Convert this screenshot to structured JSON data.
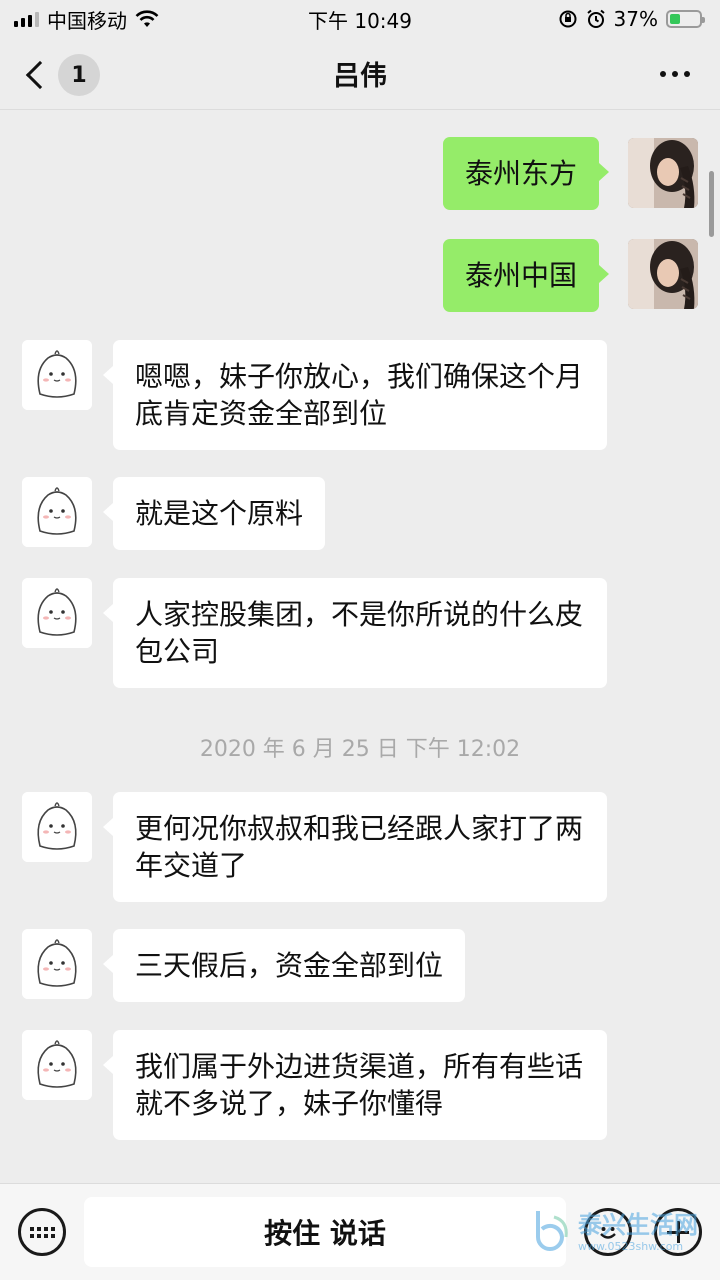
{
  "status_bar": {
    "carrier": "中国移动",
    "time": "下午 10:49",
    "battery_percent": "37%",
    "battery_level": 0.37
  },
  "header": {
    "back_count": "1",
    "title": "吕伟"
  },
  "messages": [
    {
      "side": "out",
      "text": "泰州东方"
    },
    {
      "side": "out",
      "text": "泰州中国"
    },
    {
      "side": "in",
      "text": "嗯嗯，妹子你放心，我们确保这个月底肯定资金全部到位"
    },
    {
      "side": "in",
      "text": "就是这个原料"
    },
    {
      "side": "in",
      "text": "人家控股集团，不是你所说的什么皮包公司"
    },
    {
      "side": "in",
      "text": "更何况你叔叔和我已经跟人家打了两年交道了"
    },
    {
      "side": "in",
      "text": "三天假后，资金全部到位"
    },
    {
      "side": "in",
      "text": "我们属于外边进货渠道，所有有些话就不多说了，妹子你懂得"
    }
  ],
  "timestamp": "2020 年 6 月 25 日  下午 12:02",
  "input_bar": {
    "voice_label": "按住 说话"
  },
  "watermark": {
    "main": "泰兴生活网",
    "sub": "www.0523shw.com"
  },
  "colors": {
    "outgoing_bubble": "#95ec69",
    "incoming_bubble": "#ffffff",
    "background": "#ededed"
  }
}
